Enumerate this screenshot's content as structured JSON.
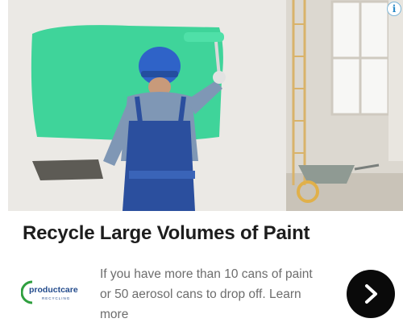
{
  "ad": {
    "headline": "Recycle Large Volumes of Paint",
    "body": "If you have more than 10 cans of paint or 50 aerosol cans to drop off. Learn more",
    "info_icon": "i",
    "cta_icon": "chevron-right-icon",
    "logo": {
      "brand": "productcare",
      "sub": "RECYCLING"
    },
    "colors": {
      "headline": "#1d1d1d",
      "body": "#6d6d6d",
      "cta_bg": "#0a0a0a",
      "paint_green": "#3fd49a",
      "worker_blue": "#2b4f9e"
    }
  }
}
